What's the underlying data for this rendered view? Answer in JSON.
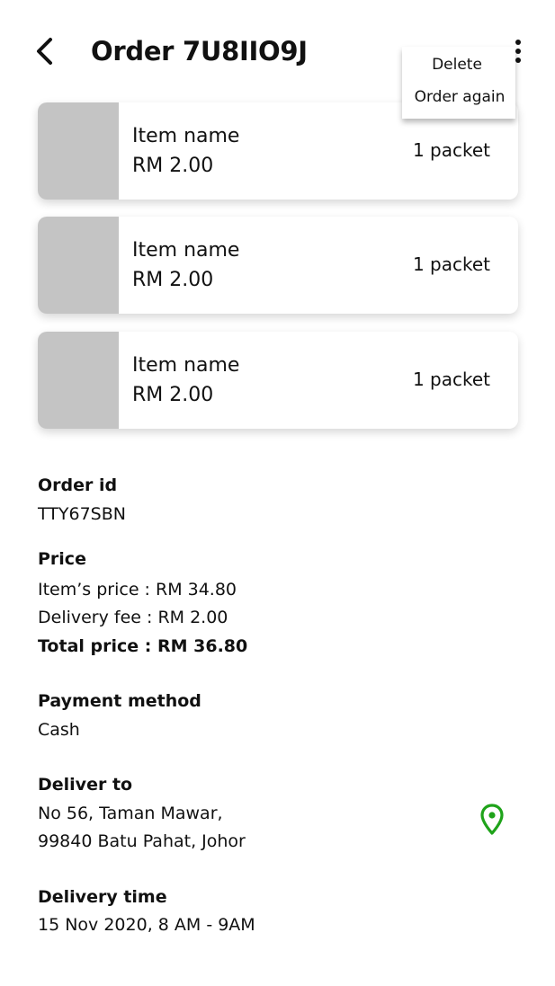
{
  "header": {
    "back_icon": "chevron-left-icon",
    "title": "Order 7U8IIO9J",
    "more_icon": "more-vertical-icon"
  },
  "menu": {
    "items": [
      "Delete",
      "Order again"
    ]
  },
  "items": [
    {
      "name": "Item name",
      "price": "RM 2.00",
      "quantity": "1 packet"
    },
    {
      "name": "Item name",
      "price": "RM 2.00",
      "quantity": "1 packet"
    },
    {
      "name": "Item name",
      "price": "RM 2.00",
      "quantity": "1 packet"
    }
  ],
  "order_id": {
    "label": "Order id",
    "value": "TTY67SBN"
  },
  "price": {
    "label": "Price",
    "items_price": "Item’s price : RM 34.80",
    "delivery_fee": "Delivery fee : RM 2.00",
    "total_price": "Total price : RM 36.80"
  },
  "payment": {
    "label": "Payment method",
    "value": "Cash"
  },
  "deliver_to": {
    "label": "Deliver to",
    "line1": "No 56, Taman Mawar,",
    "line2": "99840 Batu Pahat, Johor",
    "icon": "location-pin-icon"
  },
  "delivery_time": {
    "label": "Delivery time",
    "value": "15 Nov 2020, 8 AM - 9AM"
  },
  "colors": {
    "placeholder_gray": "#c4c4c4",
    "accent_green": "#1fa31a",
    "text": "#111111"
  }
}
